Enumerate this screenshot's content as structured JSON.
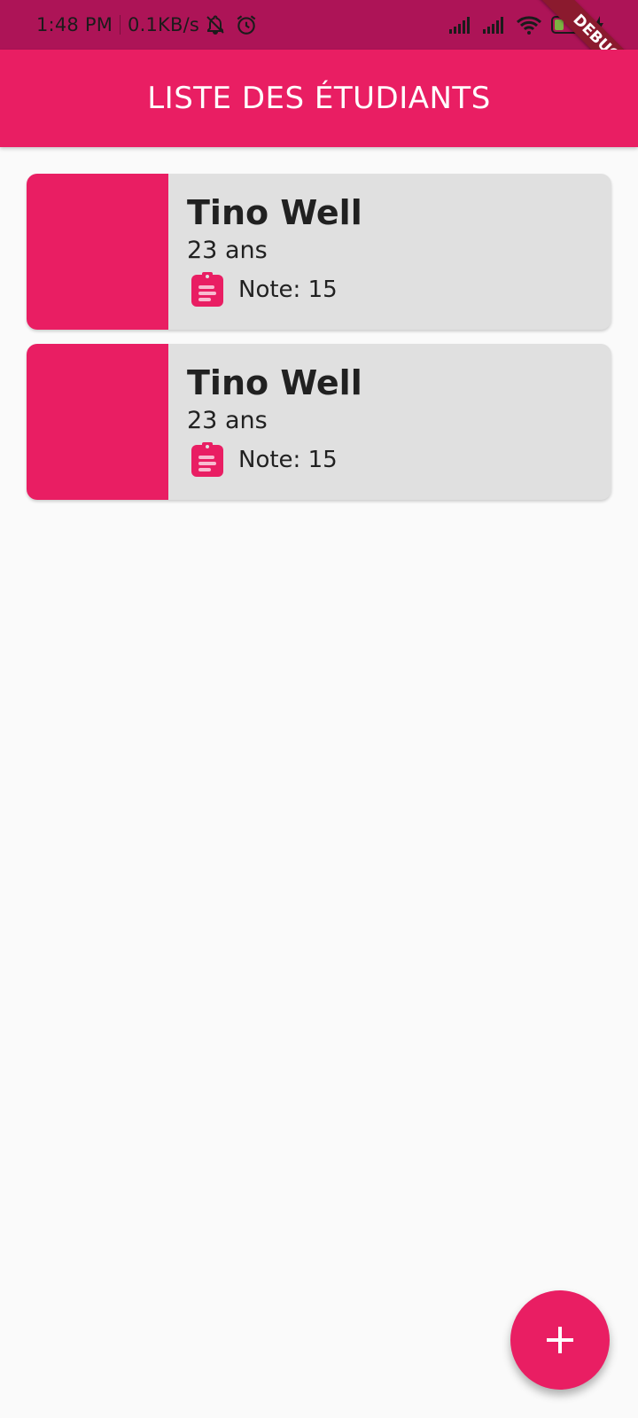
{
  "status_bar": {
    "time": "1:48 PM",
    "network_speed": "0.1KB/s",
    "icons": [
      "mute-notifications-icon",
      "alarm-icon",
      "signal-icon",
      "signal-icon",
      "wifi-icon",
      "battery-icon",
      "charging-icon"
    ],
    "debug_banner": "DEBUG"
  },
  "app_bar": {
    "title": "LISTE DES ÉTUDIANTS"
  },
  "students": [
    {
      "name": "Tino Well",
      "age": "23 ans",
      "grade": "Note: 15",
      "icon": "clipboard-icon"
    },
    {
      "name": "Tino Well",
      "age": "23 ans",
      "grade": "Note: 15",
      "icon": "clipboard-icon"
    }
  ],
  "fab": {
    "icon": "add-icon"
  },
  "colors": {
    "primary": "#e91e63",
    "primary_dark": "#ad1457",
    "card": "#e0e0e0",
    "background": "#fafafa"
  }
}
